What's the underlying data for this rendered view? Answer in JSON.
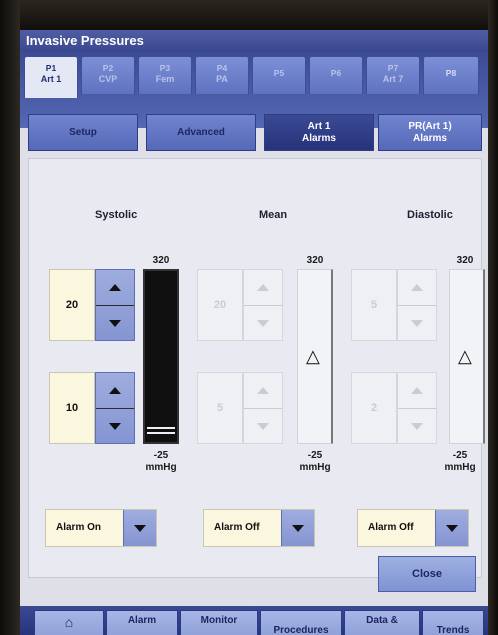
{
  "window": {
    "title": "Invasive Pressures"
  },
  "pressure_tabs": [
    {
      "line1": "P1",
      "line2": "Art 1",
      "active": true
    },
    {
      "line1": "P2",
      "line2": "CVP",
      "active": false
    },
    {
      "line1": "P3",
      "line2": "Fem",
      "active": false
    },
    {
      "line1": "P4",
      "line2": "PA",
      "active": false
    },
    {
      "line1": "P5",
      "line2": "",
      "active": false
    },
    {
      "line1": "P6",
      "line2": "",
      "active": false
    },
    {
      "line1": "P7",
      "line2": "Art 7",
      "active": false
    },
    {
      "line1": "P8",
      "line2": "",
      "active": false
    }
  ],
  "sub_tabs": [
    {
      "line1": "Setup",
      "line2": ""
    },
    {
      "line1": "Advanced",
      "line2": ""
    },
    {
      "line1": "Art 1",
      "line2": "Alarms",
      "active": true
    },
    {
      "line1": "PR(Art 1)",
      "line2": "Alarms"
    }
  ],
  "alarms": {
    "systolic": {
      "title": "Systolic",
      "high": "20",
      "low": "10",
      "scale_top": "320",
      "scale_bottom": "-25",
      "unit": "mmHg",
      "alarm_state": "Alarm On",
      "enabled": true
    },
    "mean": {
      "title": "Mean",
      "high": "20",
      "low": "5",
      "scale_top": "320",
      "scale_bottom": "-25",
      "unit": "mmHg",
      "alarm_state": "Alarm Off",
      "enabled": false
    },
    "diastolic": {
      "title": "Diastolic",
      "high": "5",
      "low": "2",
      "scale_top": "320",
      "scale_bottom": "-25",
      "unit": "mmHg",
      "alarm_state": "Alarm Off",
      "enabled": false
    }
  },
  "icons": {
    "alarm_off": "alarm-off-bell-icon",
    "dropdown": "chevron-down-icon",
    "home": "home-icon"
  },
  "close_label": "Close",
  "bottom_bar": [
    {
      "label": "",
      "icon": "home-icon"
    },
    {
      "label": "Alarm"
    },
    {
      "label": "Monitor"
    },
    {
      "label": "Procedures"
    },
    {
      "label": "Data &"
    },
    {
      "label": "Trends"
    }
  ],
  "colors": {
    "accent": "#3a4890",
    "selected_field": "#fbf7df",
    "active_scale": "#0f0f0f"
  }
}
